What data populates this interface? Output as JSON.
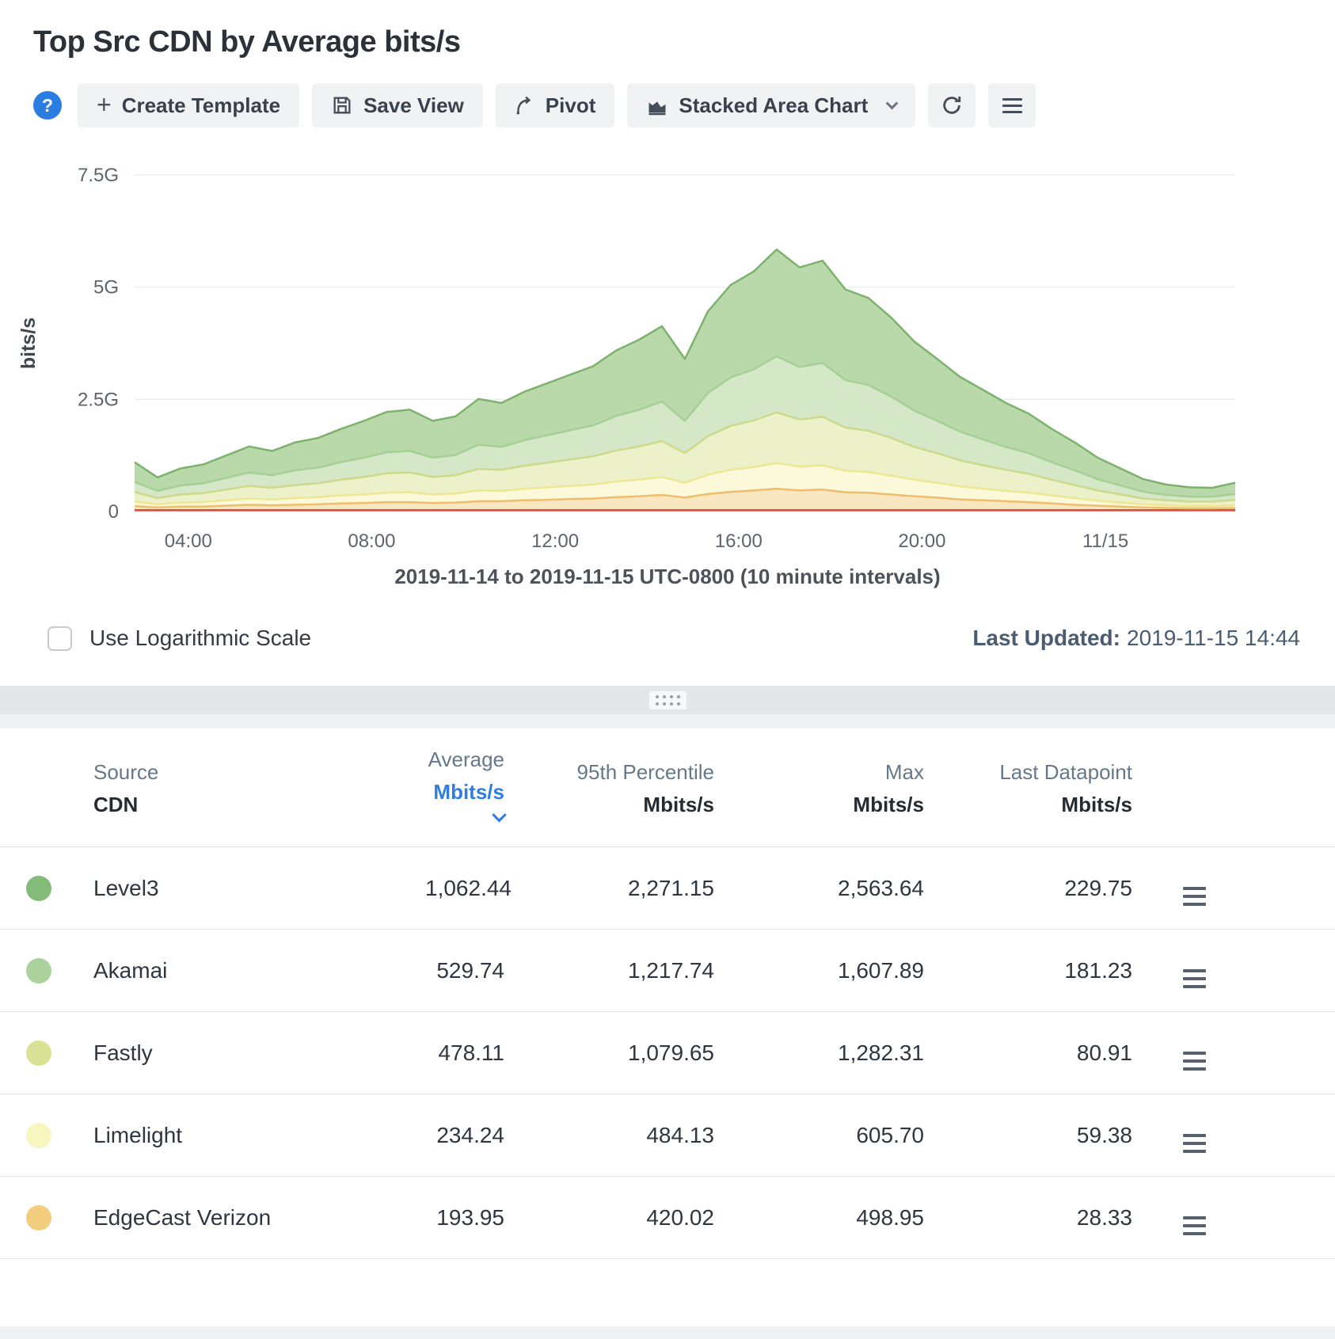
{
  "header": {
    "title": "Top Src CDN by Average bits/s"
  },
  "toolbar": {
    "help_label": "?",
    "create_template": "Create Template",
    "save_view": "Save View",
    "pivot": "Pivot",
    "chart_type": "Stacked Area Chart"
  },
  "chart_data": {
    "type": "area",
    "stacked": true,
    "title": "Top Src CDN by Average bits/s",
    "ylabel": "bits/s",
    "xlabel": "2019-11-14 to 2019-11-15 UTC-0800 (10 minute intervals)",
    "unit": "Gbits/s",
    "ylim": [
      0,
      7.5
    ],
    "grid": true,
    "legend_position": "table-below",
    "x_hours_start": 2.83,
    "x_hours_step": 0.5,
    "yticks": [
      {
        "value": 0,
        "label": "0"
      },
      {
        "value": 2.5,
        "label": "2.5G"
      },
      {
        "value": 5,
        "label": "5G"
      },
      {
        "value": 7.5,
        "label": "7.5G"
      }
    ],
    "xticks": [
      {
        "hour": 4,
        "label": "04:00"
      },
      {
        "hour": 8,
        "label": "08:00"
      },
      {
        "hour": 12,
        "label": "12:00"
      },
      {
        "hour": 16,
        "label": "16:00"
      },
      {
        "hour": 20,
        "label": "20:00"
      },
      {
        "hour": 24,
        "label": "11/15"
      }
    ],
    "stack_order": "bottom_to_top",
    "series": [
      {
        "name": "unlabeled red series",
        "line_color": "#dc4b40",
        "fill_color": "#f5beb6",
        "values": [
          0.03,
          0.03,
          0.03,
          0.03,
          0.03,
          0.03,
          0.03,
          0.03,
          0.03,
          0.03,
          0.03,
          0.03,
          0.03,
          0.03,
          0.03,
          0.03,
          0.03,
          0.03,
          0.03,
          0.03,
          0.03,
          0.03,
          0.03,
          0.03,
          0.03,
          0.03,
          0.03,
          0.03,
          0.03,
          0.03,
          0.03,
          0.03,
          0.03,
          0.03,
          0.03,
          0.03,
          0.03,
          0.03,
          0.03,
          0.03,
          0.03,
          0.03,
          0.03,
          0.03,
          0.03,
          0.03,
          0.03,
          0.03,
          0.03
        ]
      },
      {
        "name": "EdgeCast Verizon",
        "line_color": "#eebd6d",
        "fill_color": "#f8e7c1",
        "values": [
          0.09,
          0.06,
          0.08,
          0.08,
          0.1,
          0.12,
          0.11,
          0.12,
          0.13,
          0.15,
          0.16,
          0.18,
          0.18,
          0.16,
          0.17,
          0.2,
          0.2,
          0.22,
          0.23,
          0.25,
          0.26,
          0.29,
          0.31,
          0.34,
          0.28,
          0.36,
          0.41,
          0.44,
          0.48,
          0.44,
          0.46,
          0.4,
          0.39,
          0.35,
          0.31,
          0.28,
          0.24,
          0.22,
          0.2,
          0.18,
          0.15,
          0.12,
          0.1,
          0.08,
          0.06,
          0.05,
          0.04,
          0.04,
          0.05
        ]
      },
      {
        "name": "Limelight",
        "line_color": "#ece793",
        "fill_color": "#fbf9da",
        "values": [
          0.1,
          0.07,
          0.09,
          0.1,
          0.12,
          0.14,
          0.13,
          0.15,
          0.16,
          0.18,
          0.19,
          0.21,
          0.22,
          0.19,
          0.2,
          0.24,
          0.23,
          0.26,
          0.28,
          0.29,
          0.31,
          0.35,
          0.37,
          0.4,
          0.33,
          0.43,
          0.49,
          0.52,
          0.57,
          0.53,
          0.54,
          0.48,
          0.46,
          0.42,
          0.37,
          0.33,
          0.29,
          0.26,
          0.23,
          0.21,
          0.18,
          0.15,
          0.11,
          0.09,
          0.07,
          0.06,
          0.05,
          0.05,
          0.06
        ]
      },
      {
        "name": "Fastly",
        "line_color": "#cdd98a",
        "fill_color": "#ecf1c9",
        "values": [
          0.21,
          0.14,
          0.18,
          0.2,
          0.24,
          0.28,
          0.26,
          0.29,
          0.31,
          0.35,
          0.39,
          0.43,
          0.44,
          0.39,
          0.41,
          0.48,
          0.47,
          0.51,
          0.55,
          0.59,
          0.63,
          0.69,
          0.74,
          0.8,
          0.66,
          0.86,
          0.98,
          1.04,
          1.13,
          1.05,
          1.08,
          0.96,
          0.92,
          0.84,
          0.73,
          0.66,
          0.58,
          0.52,
          0.47,
          0.42,
          0.35,
          0.29,
          0.23,
          0.18,
          0.13,
          0.11,
          0.1,
          0.1,
          0.12
        ]
      },
      {
        "name": "Akamai",
        "line_color": "#a6cf95",
        "fill_color": "#d4e7c7",
        "values": [
          0.23,
          0.16,
          0.2,
          0.22,
          0.26,
          0.3,
          0.28,
          0.33,
          0.35,
          0.39,
          0.43,
          0.47,
          0.48,
          0.43,
          0.45,
          0.54,
          0.51,
          0.57,
          0.61,
          0.65,
          0.69,
          0.77,
          0.82,
          0.88,
          0.72,
          0.96,
          1.08,
          1.14,
          1.25,
          1.17,
          1.2,
          1.06,
          1.02,
          0.92,
          0.81,
          0.72,
          0.64,
          0.58,
          0.51,
          0.46,
          0.39,
          0.33,
          0.25,
          0.2,
          0.15,
          0.12,
          0.11,
          0.11,
          0.13
        ]
      },
      {
        "name": "Level3",
        "line_color": "#7db26d",
        "fill_color": "#b9d9ab",
        "values": [
          0.44,
          0.3,
          0.38,
          0.42,
          0.5,
          0.58,
          0.54,
          0.62,
          0.66,
          0.74,
          0.82,
          0.9,
          0.92,
          0.82,
          0.86,
          1.02,
          0.98,
          1.08,
          1.16,
          1.24,
          1.32,
          1.46,
          1.56,
          1.68,
          1.38,
          1.82,
          2.06,
          2.18,
          2.38,
          2.22,
          2.28,
          2.02,
          1.94,
          1.76,
          1.54,
          1.38,
          1.22,
          1.1,
          0.98,
          0.88,
          0.74,
          0.62,
          0.48,
          0.38,
          0.28,
          0.23,
          0.21,
          0.2,
          0.25
        ]
      }
    ]
  },
  "controls": {
    "log_scale_label": "Use Logarithmic Scale",
    "log_scale_checked": false,
    "last_updated_label": "Last Updated:",
    "last_updated_value": "2019-11-15 14:44"
  },
  "table": {
    "columns": [
      {
        "line1": "Source",
        "line2": "CDN"
      },
      {
        "line1": "Average",
        "line2": "Mbits/s",
        "sorted": "desc"
      },
      {
        "line1": "95th Percentile",
        "line2": "Mbits/s"
      },
      {
        "line1": "Max",
        "line2": "Mbits/s"
      },
      {
        "line1": "Last Datapoint",
        "line2": "Mbits/s"
      }
    ],
    "rows": [
      {
        "name": "Level3",
        "color": "#85bb78",
        "average": "1,062.44",
        "p95": "2,271.15",
        "max": "2,563.64",
        "last": "229.75"
      },
      {
        "name": "Akamai",
        "color": "#abd29c",
        "average": "529.74",
        "p95": "1,217.74",
        "max": "1,607.89",
        "last": "181.23"
      },
      {
        "name": "Fastly",
        "color": "#d9e294",
        "average": "478.11",
        "p95": "1,079.65",
        "max": "1,282.31",
        "last": "80.91"
      },
      {
        "name": "Limelight",
        "color": "#f8f6bf",
        "average": "234.24",
        "p95": "484.13",
        "max": "605.70",
        "last": "59.38"
      },
      {
        "name": "EdgeCast Verizon",
        "color": "#f2cd7d",
        "average": "193.95",
        "p95": "420.02",
        "max": "498.95",
        "last": "28.33"
      }
    ]
  }
}
